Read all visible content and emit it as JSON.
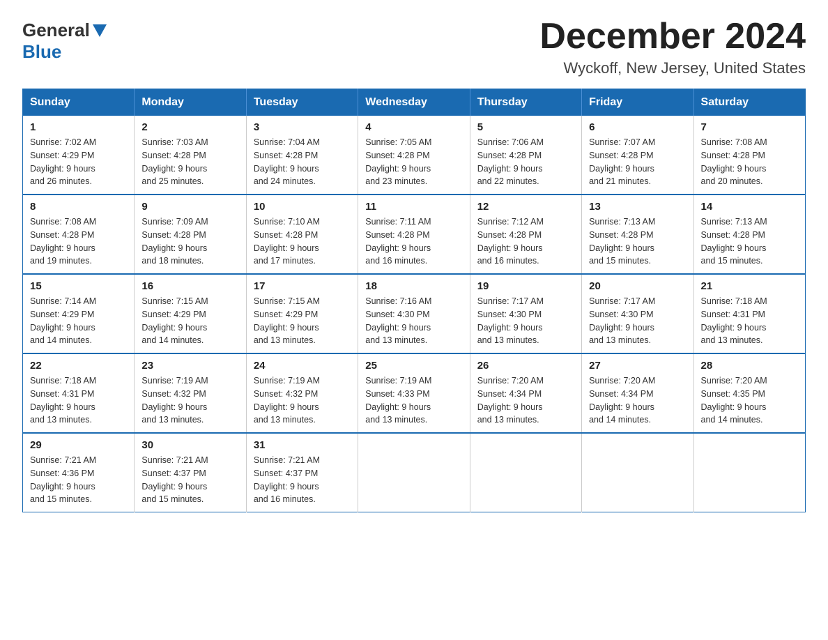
{
  "header": {
    "logo_general": "General",
    "logo_blue": "Blue",
    "month_title": "December 2024",
    "location": "Wyckoff, New Jersey, United States"
  },
  "weekdays": [
    "Sunday",
    "Monday",
    "Tuesday",
    "Wednesday",
    "Thursday",
    "Friday",
    "Saturday"
  ],
  "weeks": [
    [
      {
        "day": "1",
        "sunrise": "7:02 AM",
        "sunset": "4:29 PM",
        "daylight": "9 hours and 26 minutes."
      },
      {
        "day": "2",
        "sunrise": "7:03 AM",
        "sunset": "4:28 PM",
        "daylight": "9 hours and 25 minutes."
      },
      {
        "day": "3",
        "sunrise": "7:04 AM",
        "sunset": "4:28 PM",
        "daylight": "9 hours and 24 minutes."
      },
      {
        "day": "4",
        "sunrise": "7:05 AM",
        "sunset": "4:28 PM",
        "daylight": "9 hours and 23 minutes."
      },
      {
        "day": "5",
        "sunrise": "7:06 AM",
        "sunset": "4:28 PM",
        "daylight": "9 hours and 22 minutes."
      },
      {
        "day": "6",
        "sunrise": "7:07 AM",
        "sunset": "4:28 PM",
        "daylight": "9 hours and 21 minutes."
      },
      {
        "day": "7",
        "sunrise": "7:08 AM",
        "sunset": "4:28 PM",
        "daylight": "9 hours and 20 minutes."
      }
    ],
    [
      {
        "day": "8",
        "sunrise": "7:08 AM",
        "sunset": "4:28 PM",
        "daylight": "9 hours and 19 minutes."
      },
      {
        "day": "9",
        "sunrise": "7:09 AM",
        "sunset": "4:28 PM",
        "daylight": "9 hours and 18 minutes."
      },
      {
        "day": "10",
        "sunrise": "7:10 AM",
        "sunset": "4:28 PM",
        "daylight": "9 hours and 17 minutes."
      },
      {
        "day": "11",
        "sunrise": "7:11 AM",
        "sunset": "4:28 PM",
        "daylight": "9 hours and 16 minutes."
      },
      {
        "day": "12",
        "sunrise": "7:12 AM",
        "sunset": "4:28 PM",
        "daylight": "9 hours and 16 minutes."
      },
      {
        "day": "13",
        "sunrise": "7:13 AM",
        "sunset": "4:28 PM",
        "daylight": "9 hours and 15 minutes."
      },
      {
        "day": "14",
        "sunrise": "7:13 AM",
        "sunset": "4:28 PM",
        "daylight": "9 hours and 15 minutes."
      }
    ],
    [
      {
        "day": "15",
        "sunrise": "7:14 AM",
        "sunset": "4:29 PM",
        "daylight": "9 hours and 14 minutes."
      },
      {
        "day": "16",
        "sunrise": "7:15 AM",
        "sunset": "4:29 PM",
        "daylight": "9 hours and 14 minutes."
      },
      {
        "day": "17",
        "sunrise": "7:15 AM",
        "sunset": "4:29 PM",
        "daylight": "9 hours and 13 minutes."
      },
      {
        "day": "18",
        "sunrise": "7:16 AM",
        "sunset": "4:30 PM",
        "daylight": "9 hours and 13 minutes."
      },
      {
        "day": "19",
        "sunrise": "7:17 AM",
        "sunset": "4:30 PM",
        "daylight": "9 hours and 13 minutes."
      },
      {
        "day": "20",
        "sunrise": "7:17 AM",
        "sunset": "4:30 PM",
        "daylight": "9 hours and 13 minutes."
      },
      {
        "day": "21",
        "sunrise": "7:18 AM",
        "sunset": "4:31 PM",
        "daylight": "9 hours and 13 minutes."
      }
    ],
    [
      {
        "day": "22",
        "sunrise": "7:18 AM",
        "sunset": "4:31 PM",
        "daylight": "9 hours and 13 minutes."
      },
      {
        "day": "23",
        "sunrise": "7:19 AM",
        "sunset": "4:32 PM",
        "daylight": "9 hours and 13 minutes."
      },
      {
        "day": "24",
        "sunrise": "7:19 AM",
        "sunset": "4:32 PM",
        "daylight": "9 hours and 13 minutes."
      },
      {
        "day": "25",
        "sunrise": "7:19 AM",
        "sunset": "4:33 PM",
        "daylight": "9 hours and 13 minutes."
      },
      {
        "day": "26",
        "sunrise": "7:20 AM",
        "sunset": "4:34 PM",
        "daylight": "9 hours and 13 minutes."
      },
      {
        "day": "27",
        "sunrise": "7:20 AM",
        "sunset": "4:34 PM",
        "daylight": "9 hours and 14 minutes."
      },
      {
        "day": "28",
        "sunrise": "7:20 AM",
        "sunset": "4:35 PM",
        "daylight": "9 hours and 14 minutes."
      }
    ],
    [
      {
        "day": "29",
        "sunrise": "7:21 AM",
        "sunset": "4:36 PM",
        "daylight": "9 hours and 15 minutes."
      },
      {
        "day": "30",
        "sunrise": "7:21 AM",
        "sunset": "4:37 PM",
        "daylight": "9 hours and 15 minutes."
      },
      {
        "day": "31",
        "sunrise": "7:21 AM",
        "sunset": "4:37 PM",
        "daylight": "9 hours and 16 minutes."
      },
      null,
      null,
      null,
      null
    ]
  ],
  "labels": {
    "sunrise": "Sunrise:",
    "sunset": "Sunset:",
    "daylight": "Daylight:"
  }
}
